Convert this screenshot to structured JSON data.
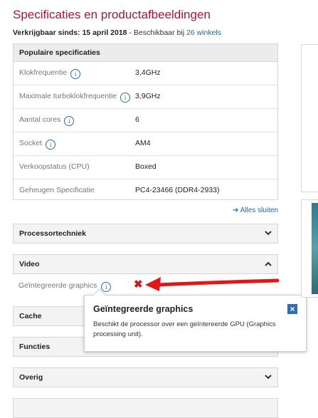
{
  "title": "Specificaties en productafbeeldingen",
  "availability": {
    "label": "Verkrijgbaar sinds:",
    "date": "15 april 2018",
    "separator": " - Beschikbaar bij ",
    "link": "26 winkels"
  },
  "popular": {
    "heading": "Populaire specificaties",
    "rows": [
      {
        "label": "Klokfrequentie",
        "value": "3,4GHz",
        "has_info": true
      },
      {
        "label": "Maximale turboklokfrequentie",
        "value": "3,9GHz",
        "has_info": true
      },
      {
        "label": "Aantal cores",
        "value": "6",
        "has_info": true
      },
      {
        "label": "Socket",
        "value": "AM4",
        "has_info": true
      },
      {
        "label": "Verkoopstatus (CPU)",
        "value": "Boxed",
        "has_info": false
      },
      {
        "label": "Geheugen Specificatie",
        "value": "PC4-23466 (DDR4-2933)",
        "has_info": false
      }
    ]
  },
  "close_all": "➔ Alles sluiten",
  "sections": {
    "processortechniek": "Processortechniek",
    "video": "Video",
    "cache": "Cache",
    "functies": "Functies",
    "overig": "Overig"
  },
  "video_row": {
    "label": "Geïntegreerde graphics",
    "value_icon": "cross-icon"
  },
  "tooltip": {
    "title": "Geïntegreerde graphics",
    "body": "Beschikt de processor over een geïntereerde GPU (Graphics processing unit)."
  },
  "icons": {
    "info": "i",
    "chevron_down": "⌄",
    "chevron_up": "⌃",
    "close": "×",
    "cross": "✖"
  },
  "colors": {
    "brand": "#b0123b",
    "link": "#2266aa",
    "cross": "#d01a1a",
    "arrow": "#e01818"
  }
}
